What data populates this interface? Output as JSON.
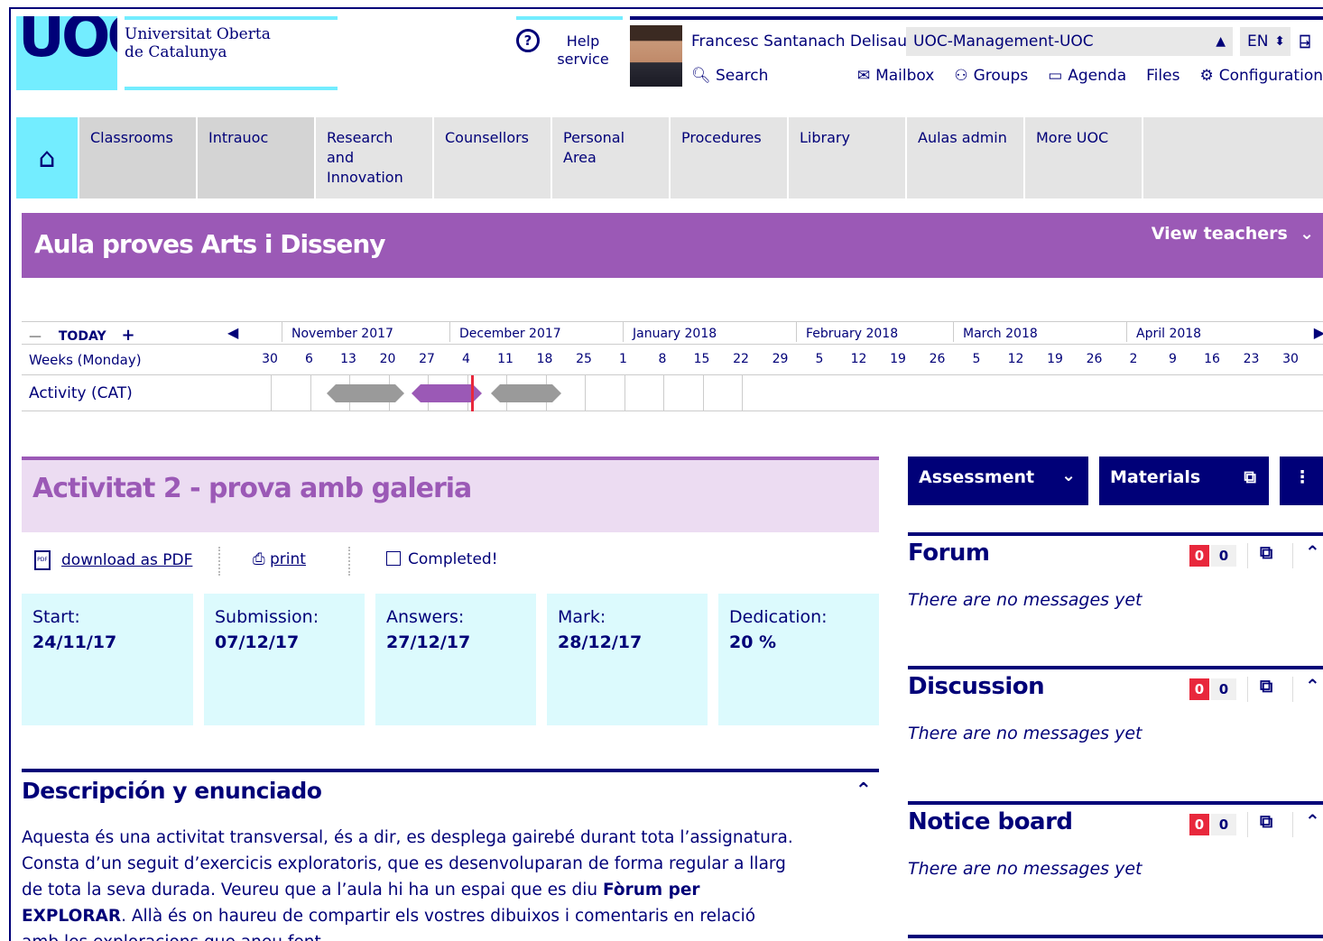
{
  "header": {
    "logo_text": "UOC",
    "university_name_line1": "Universitat Oberta",
    "university_name_line2": "de Catalunya",
    "help_label_line1": "Help",
    "help_label_line2": "service",
    "user_name": "Francesc Santanach Delisau",
    "campus_select_value": "UOC-Management-UOC",
    "language_value": "EN",
    "search_label": "Search",
    "links": {
      "mailbox": "Mailbox",
      "groups": "Groups",
      "agenda": "Agenda",
      "files": "Files",
      "configuration": "Configuration"
    }
  },
  "nav": {
    "home_icon": "home-icon",
    "items": [
      {
        "line1": "Classrooms",
        "line2": ""
      },
      {
        "line1": "Intrauoc",
        "line2": ""
      },
      {
        "line1": "Research and",
        "line2": "Innovation"
      },
      {
        "line1": "Counsellors",
        "line2": ""
      },
      {
        "line1": "Personal Area",
        "line2": ""
      },
      {
        "line1": "Procedures",
        "line2": ""
      },
      {
        "line1": "Library",
        "line2": ""
      },
      {
        "line1": "Aulas admin",
        "line2": ""
      },
      {
        "line1": "More UOC",
        "line2": ""
      }
    ]
  },
  "classroom": {
    "title": "Aula proves Arts i Disseny",
    "view_teachers": "View teachers",
    "color": "#9b59b6"
  },
  "timeline": {
    "today_label": "TODAY",
    "weeks_label": "Weeks (Monday)",
    "activity_label": "Activity (CAT)",
    "months": [
      "November 2017",
      "December 2017",
      "January 2018",
      "February 2018",
      "March 2018",
      "April 2018"
    ],
    "weeks": [
      "30",
      "6",
      "13",
      "20",
      "27",
      "4",
      "11",
      "18",
      "25",
      "1",
      "8",
      "15",
      "22",
      "29",
      "5",
      "12",
      "19",
      "26",
      "5",
      "12",
      "19",
      "26",
      "2",
      "9",
      "16",
      "23",
      "30"
    ]
  },
  "activity": {
    "title": "Activitat 2 - prova amb galeria",
    "download_pdf": "download as PDF",
    "print": "print",
    "completed": "Completed!",
    "cards": [
      {
        "label": "Start:",
        "value": "24/11/17"
      },
      {
        "label": "Submission:",
        "value": "07/12/17"
      },
      {
        "label": "Answers:",
        "value": "27/12/17"
      },
      {
        "label": "Mark:",
        "value": "28/12/17"
      },
      {
        "label": "Dedication:",
        "value": "20 %"
      }
    ]
  },
  "description": {
    "title": "Descripción y enunciado",
    "p1": "Aquesta és una activitat transversal, és a dir, es desplega gairebé durant tota l’assignatura. Consta d’un seguit d’exercicis exploratoris, que es desenvoluparan de forma regular a llarg de tota la seva durada. Veureu que a l’aula hi ha un espai que es diu ",
    "p1_bold": "Fòrum per EXPLORAR",
    "p2": ". Allà és on haureu de compartir els vostres dibuixos i comentaris en relació amb les exploracions que aneu fent."
  },
  "sidebar": {
    "assessment": "Assessment",
    "materials": "Materials",
    "panels": [
      {
        "title": "Forum",
        "unread": "0",
        "total": "0",
        "empty": "There are no messages yet"
      },
      {
        "title": "Discussion",
        "unread": "0",
        "total": "0",
        "empty": "There are no messages yet"
      },
      {
        "title": "Notice board",
        "unread": "0",
        "total": "0",
        "empty": "There are no messages yet"
      }
    ]
  }
}
